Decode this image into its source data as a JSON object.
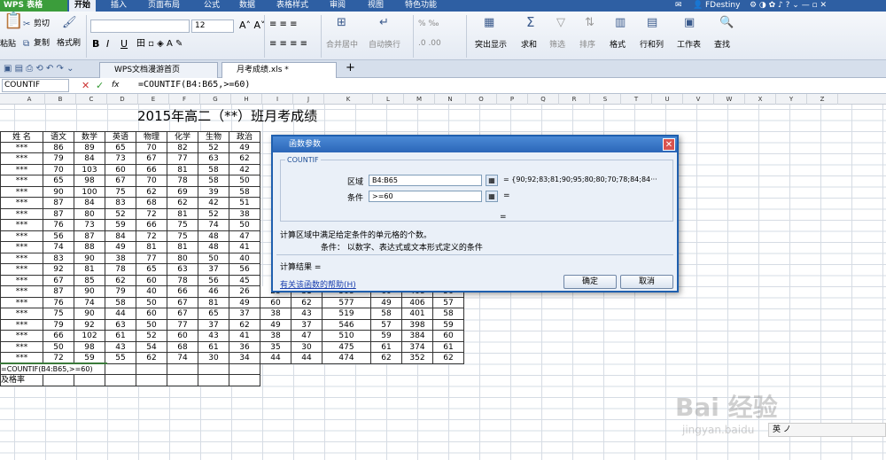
{
  "menu": {
    "logo": "WPS 表格",
    "tabs": [
      "开始",
      "插入",
      "页面布局",
      "公式",
      "数据",
      "表格样式",
      "审阅",
      "视图",
      "特色功能"
    ],
    "active": "开始",
    "user": "FDestiny"
  },
  "ribbon": {
    "paste": "粘贴",
    "cut": "剪切",
    "copy": "复制",
    "format_painter": "格式刷",
    "font_size": "12",
    "merge": "合并居中",
    "wrap": "自动换行",
    "highlight": "突出显示",
    "sum": "求和",
    "filter": "筛选",
    "sort": "排序",
    "format": "格式",
    "rows_cols": "行和列",
    "worksheet": "工作表",
    "find": "查找",
    "bold": "B",
    "italic": "I",
    "underline": "U"
  },
  "tabs": {
    "home": "WPS文档漫游首页",
    "doc": "月考成绩.xls *",
    "add": "+"
  },
  "formula_bar": {
    "namebox": "COUNTIF",
    "fx": "fx",
    "formula": "=COUNTIF(B4:B65,>=60)"
  },
  "columns": [
    "A",
    "B",
    "C",
    "D",
    "E",
    "F",
    "G",
    "H",
    "I",
    "J",
    "K",
    "L",
    "M",
    "N",
    "O",
    "P",
    "Q",
    "R",
    "S",
    "T",
    "U",
    "V",
    "W",
    "X",
    "Y",
    "Z"
  ],
  "sheet": {
    "title": "2015年高二（**）班月考成绩",
    "headers": [
      "姓  名",
      "语文",
      "数学",
      "英语",
      "物理",
      "化学",
      "生物",
      "政治"
    ],
    "rows": [
      [
        "***",
        "86",
        "89",
        "65",
        "70",
        "82",
        "52",
        "49"
      ],
      [
        "***",
        "79",
        "84",
        "73",
        "67",
        "77",
        "63",
        "62"
      ],
      [
        "***",
        "70",
        "103",
        "60",
        "66",
        "81",
        "58",
        "42"
      ],
      [
        "***",
        "65",
        "98",
        "67",
        "70",
        "78",
        "58",
        "50"
      ],
      [
        "***",
        "90",
        "100",
        "75",
        "62",
        "69",
        "39",
        "58"
      ],
      [
        "***",
        "87",
        "84",
        "83",
        "68",
        "62",
        "42",
        "51"
      ],
      [
        "***",
        "87",
        "80",
        "52",
        "72",
        "81",
        "52",
        "38"
      ],
      [
        "***",
        "76",
        "73",
        "59",
        "66",
        "75",
        "74",
        "50"
      ],
      [
        "***",
        "56",
        "87",
        "84",
        "72",
        "75",
        "48",
        "47"
      ],
      [
        "***",
        "74",
        "88",
        "49",
        "81",
        "81",
        "48",
        "41"
      ],
      [
        "***",
        "83",
        "90",
        "38",
        "77",
        "80",
        "50",
        "40"
      ],
      [
        "***",
        "92",
        "81",
        "78",
        "65",
        "63",
        "37",
        "56"
      ],
      [
        "***",
        "67",
        "85",
        "62",
        "60",
        "78",
        "56",
        "45"
      ],
      [
        "***",
        "87",
        "90",
        "79",
        "40",
        "66",
        "46",
        "26"
      ],
      [
        "***",
        "76",
        "74",
        "58",
        "50",
        "67",
        "81",
        "49"
      ],
      [
        "***",
        "75",
        "90",
        "44",
        "60",
        "67",
        "65",
        "37"
      ],
      [
        "***",
        "79",
        "92",
        "63",
        "50",
        "77",
        "37",
        "62"
      ],
      [
        "***",
        "66",
        "102",
        "61",
        "52",
        "60",
        "43",
        "41"
      ],
      [
        "***",
        "50",
        "98",
        "43",
        "54",
        "68",
        "61",
        "36"
      ],
      [
        "***",
        "72",
        "59",
        "55",
        "62",
        "74",
        "30",
        "34"
      ]
    ],
    "extra_rows": [
      [
        "23",
        "31",
        "508",
        "60",
        "408",
        "56"
      ],
      [
        "60",
        "62",
        "577",
        "49",
        "406",
        "57"
      ],
      [
        "38",
        "43",
        "519",
        "58",
        "401",
        "58"
      ],
      [
        "49",
        "37",
        "546",
        "57",
        "398",
        "59"
      ],
      [
        "38",
        "47",
        "510",
        "59",
        "384",
        "60"
      ],
      [
        "35",
        "30",
        "475",
        "61",
        "374",
        "61"
      ],
      [
        "44",
        "44",
        "474",
        "62",
        "352",
        "62"
      ]
    ],
    "formula_cell": "=COUNTIF(B4:B65,>=60)",
    "pass_rate": "及格率"
  },
  "dialog": {
    "title": "函数参数",
    "func": "COUNTIF",
    "range_label": "区域",
    "range_value": "B4:B65",
    "range_result": "= {90;92;83;81;90;95;80;80;70;78;84;84···",
    "cond_label": "条件",
    "cond_value": ">=60",
    "cond_result": "=",
    "total_eq": "=",
    "desc": "计算区域中满足给定条件的单元格的个数。",
    "param_desc": "条件：  以数字、表达式或文本形式定义的条件",
    "result_label": "计算结果 =",
    "help_link": "有关该函数的帮助(H)",
    "ok": "确定",
    "cancel": "取消"
  },
  "watermark": {
    "main": "Bai 经验",
    "sub": "jingyan.baidu"
  },
  "ime": "英 ノ"
}
